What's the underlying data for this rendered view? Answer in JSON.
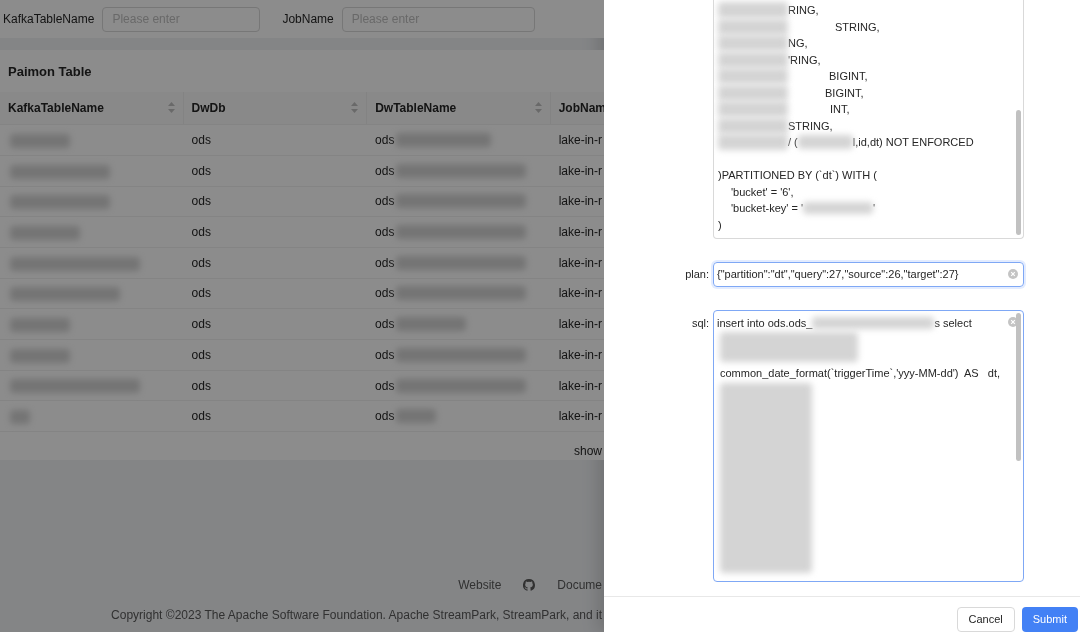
{
  "filters": [
    {
      "label": "KafkaTableName",
      "placeholder": "Please enter"
    },
    {
      "label": "JobName",
      "placeholder": "Please enter"
    }
  ],
  "table": {
    "title": "Paimon Table",
    "columns": [
      "KafkaTableName",
      "DwDb",
      "DwTableName",
      "JobNam"
    ],
    "rows": [
      {
        "dw_db": "ods",
        "dw_table": "ods",
        "job": "lake-in-r"
      },
      {
        "dw_db": "ods",
        "dw_table": "ods",
        "job": "lake-in-r"
      },
      {
        "dw_db": "ods",
        "dw_table": "ods",
        "job": "lake-in-r"
      },
      {
        "dw_db": "ods",
        "dw_table": "ods",
        "job": "lake-in-r"
      },
      {
        "dw_db": "ods",
        "dw_table": "ods",
        "job": "lake-in-r"
      },
      {
        "dw_db": "ods",
        "dw_table": "ods",
        "job": "lake-in-r"
      },
      {
        "dw_db": "ods",
        "dw_table": "ods",
        "job": "lake-in-r"
      },
      {
        "dw_db": "ods",
        "dw_table": "ods",
        "job": "lake-in-r"
      },
      {
        "dw_db": "ods",
        "dw_table": "ods",
        "job": "lake-in-r"
      },
      {
        "dw_db": "ods",
        "dw_table": "ods",
        "job": "lake-in-r"
      }
    ],
    "pagination": "show"
  },
  "footer": {
    "links": [
      "Website",
      "Docume"
    ],
    "copyright": "Copyright ©2023 The Apache Software Foundation. Apache StreamPark, StreamPark, and it"
  },
  "drawer": {
    "ddl_lines": [
      "RING,",
      "STRING,",
      "NG,",
      "'RING,",
      "BIGINT,",
      "BIGINT,",
      "INT,",
      "STRING,",
      "/ (",
      "l,id,dt) NOT ENFORCED",
      ")PARTITIONED BY (`dt`) WITH (",
      "'bucket' = '6',",
      "'bucket-key' = '",
      "'",
      ")"
    ],
    "plan": {
      "label": "plan:",
      "value": "{\"partition\":\"dt\",\"query\":27,\"source\":26,\"target\":27}"
    },
    "sql": {
      "label": "sql:",
      "first_line": "insert into ods.ods_",
      "first_line_end": "s select",
      "date_line": "common_date_format(`triggerTime`,'yyy-MM-dd')  AS   dt,"
    },
    "buttons": [
      {
        "label": "Cancel",
        "kind": "default"
      },
      {
        "label": "Submit",
        "kind": "primary"
      }
    ]
  }
}
